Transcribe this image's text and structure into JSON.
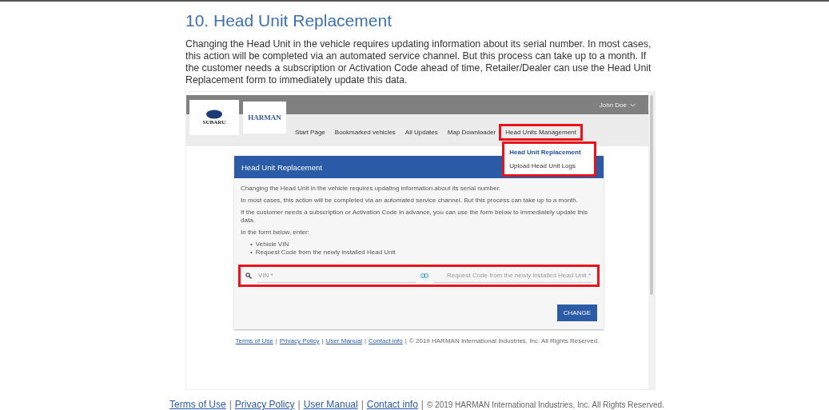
{
  "heading": "10. Head Unit Replacement",
  "intro": "Changing the Head Unit in the vehicle requires updating information about its serial number. In most cases, this action will be completed via an automated service channel. But this process can take up to a month. If the customer needs a subscription or Activation Code ahead of time, Retailer/Dealer can use the Head Unit Replacement form to immediately update this data.",
  "screenshot": {
    "user": "John Doe",
    "logos": [
      "SUBARU",
      "HARMAN"
    ],
    "nav": [
      {
        "label": "Start Page",
        "highlighted": false
      },
      {
        "label": "Bookmarked vehicles",
        "highlighted": false
      },
      {
        "label": "All Updates",
        "highlighted": false
      },
      {
        "label": "Map Downloader",
        "highlighted": false
      },
      {
        "label": "Head Units Management",
        "highlighted": true,
        "menu": [
          {
            "label": "Head Unit Replacement",
            "selected": true
          },
          {
            "label": "Upload Head Unit Logs",
            "selected": false
          }
        ]
      }
    ],
    "card": {
      "title": "Head Unit Replacement",
      "paragraphs": [
        "Changing the Head Unit in the vehicle requires updating information about its serial number.",
        "In most cases, this action will be completed via an automated service channel. But this process can take up to a month.",
        "If the customer needs a subscription or Activation Code in advance, you can use the form below to immediately update this data.",
        "In the form below, enter:"
      ],
      "list": [
        {
          "bullet": "•",
          "text": "Vehicle VIN"
        },
        {
          "bullet": "•",
          "text": "Request Code from the newly installed Head Unit"
        }
      ],
      "fields": [
        {
          "placeholder": "VIN *"
        },
        {
          "placeholder": "Request Code from the newly installed Head Unit *"
        }
      ],
      "fields_highlighted": true,
      "button": "CHANGE"
    },
    "footer_links": [
      "Terms of Use",
      "Privacy Policy",
      "User Manual",
      "Contact info"
    ],
    "separator": "|",
    "copyright": "© 2019 HARMAN International Industries, Inc. All Rights Reserved."
  },
  "footer_links": [
    "Terms of Use",
    "Privacy Policy",
    "User Manual",
    "Contact info"
  ],
  "separator": "|",
  "copyright": "© 2019 HARMAN International Industries, Inc. All Rights Reserved."
}
